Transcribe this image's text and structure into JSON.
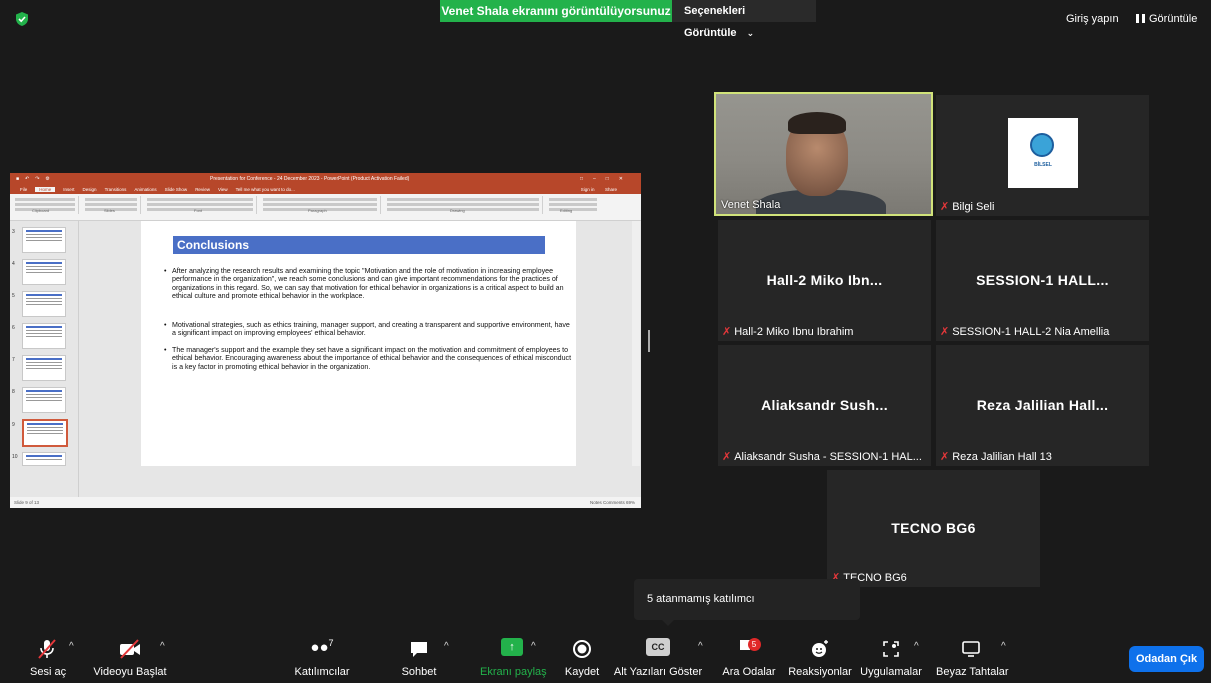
{
  "top": {
    "shield_icon": "green-shield-icon",
    "share_banner": "Venet Shala ekranını görüntülüyorsunuz",
    "view_options": "Seçenekleri Görüntüle",
    "sign_in": "Giriş yapın",
    "view": "Görüntüle"
  },
  "shared_screen": {
    "title": "Presentation for Conference - 24 December 2023 - PowerPoint (Product Activation Failed)",
    "tabs": [
      "File",
      "Home",
      "Insert",
      "Design",
      "Transitions",
      "Animations",
      "Slide Show",
      "Review",
      "View",
      "Tell me what you want to do..."
    ],
    "sign_in": "Sign in",
    "share": "Share",
    "ribbon_groups": [
      "Clipboard",
      "Slides",
      "Font",
      "Paragraph",
      "Drawing",
      "Editing"
    ],
    "thumb_numbers": [
      "3",
      "4",
      "5",
      "6",
      "7",
      "8",
      "9",
      "10"
    ],
    "slide_heading": "Conclusions",
    "bullets": [
      "After analyzing the research results and examining the topic \"Motivation and the role of motivation in increasing employee performance in the organization\", we reach some conclusions and can give important recommendations for the practices of organizations in this regard. So, we can say that motivation for ethical behavior in organizations is a critical aspect to build an ethical culture and promote ethical behavior in the workplace.",
      "Motivational strategies, such as ethics training, manager support, and creating a transparent and supportive environment, have a significant impact on improving employees' ethical behavior.",
      "The manager's support and the example they set have a significant impact on the motivation and commitment of employees to ethical behavior. Encouraging awareness about the importance of ethical behavior and the consequences of ethical misconduct is a key factor in promoting ethical behavior in the organization."
    ],
    "status_left": "Slide 9 of 13",
    "status_right": "Notes   Comments     69%"
  },
  "participants": {
    "camera_name": "Venet Shala",
    "bilgi_name": "Bilgi Seli",
    "bilgi_logo_text": "BİLSEL",
    "tiles": [
      {
        "big": "Hall-2 Miko Ibn...",
        "name": "Hall-2 Miko Ibnu Ibrahim"
      },
      {
        "big": "SESSION-1 HALL...",
        "name": "SESSION-1 HALL-2 Nia Amellia"
      },
      {
        "big": "Aliaksandr Sush...",
        "name": "Aliaksandr Susha - SESSION-1 HAL..."
      },
      {
        "big": "Reza Jalilian Hall...",
        "name": "Reza Jalilian Hall 13"
      },
      {
        "big": "TECNO BG6",
        "name": "TECNO BG6"
      }
    ]
  },
  "tooltip": "5 atanmamış katılımcı",
  "toolbar": {
    "mute": "Sesi aç",
    "video": "Videoyu Başlat",
    "participants": "Katılımcılar",
    "participants_count": "7",
    "chat": "Sohbet",
    "share": "Ekranı paylaş",
    "record": "Kaydet",
    "captions": "Alt Yazıları Göster",
    "captions_icon": "CC",
    "breakout": "Ara Odalar",
    "breakout_badge": "5",
    "reactions": "Reaksiyonlar",
    "apps": "Uygulamalar",
    "whiteboard": "Beyaz Tahtalar",
    "leave": "Odadan Çık"
  },
  "colors": {
    "accent_green": "#23b24b",
    "active_speaker": "#d1e37a",
    "leave_blue": "#0e71eb",
    "ppt_red": "#b7472a",
    "mute_red": "#e5373a"
  }
}
